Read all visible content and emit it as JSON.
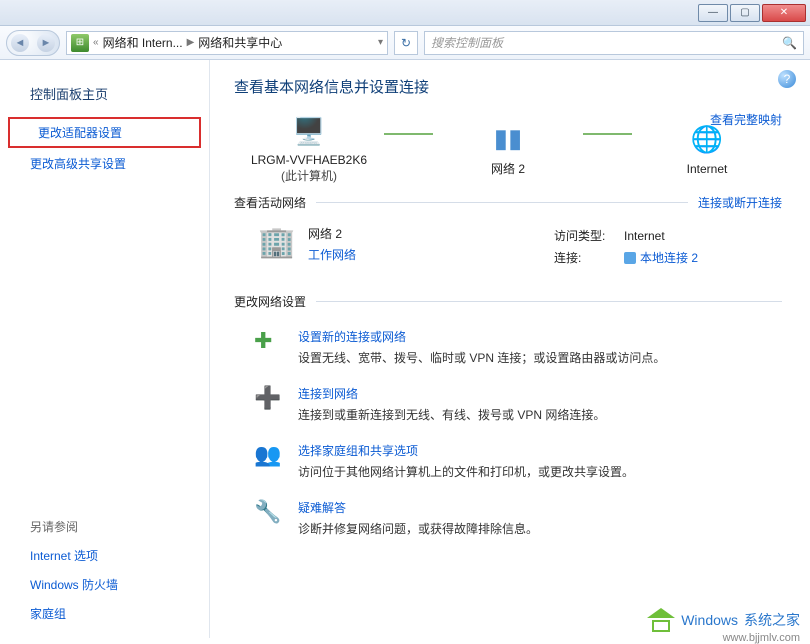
{
  "titlebar": {
    "min": "—",
    "max": "▢",
    "close": "✕"
  },
  "addrbar": {
    "bc1": "网络和 Intern...",
    "bc2": "网络和共享中心",
    "search_placeholder": "搜索控制面板"
  },
  "sidebar": {
    "title": "控制面板主页",
    "links": [
      "更改适配器设置",
      "更改高级共享设置"
    ],
    "see_also": "另请参阅",
    "bottom_links": [
      "Internet 选项",
      "Windows 防火墙",
      "家庭组"
    ]
  },
  "main": {
    "h1": "查看基本网络信息并设置连接",
    "view_map": "查看完整映射",
    "nodes": {
      "pc": "LRGM-VVFHAEB2K6",
      "pc_sub": "(此计算机)",
      "net": "网络  2",
      "internet": "Internet"
    },
    "active_hdr": "查看活动网络",
    "active_right": "连接或断开连接",
    "active": {
      "name": "网络  2",
      "type": "工作网络",
      "access_k": "访问类型:",
      "access_v": "Internet",
      "conn_k": "连接:",
      "conn_v": "本地连接 2"
    },
    "change_hdr": "更改网络设置",
    "settings": [
      {
        "icon": "✚",
        "title": "设置新的连接或网络",
        "desc": "设置无线、宽带、拨号、临时或 VPN 连接；或设置路由器或访问点。"
      },
      {
        "icon": "➕",
        "title": "连接到网络",
        "desc": "连接到或重新连接到无线、有线、拨号或 VPN 网络连接。"
      },
      {
        "icon": "👥",
        "title": "选择家庭组和共享选项",
        "desc": "访问位于其他网络计算机上的文件和打印机，或更改共享设置。"
      },
      {
        "icon": "🔧",
        "title": "疑难解答",
        "desc": "诊断并修复网络问题，或获得故障排除信息。"
      }
    ]
  },
  "watermark": {
    "brand": "Windows",
    "sub": "系统之家",
    "url": "www.bjjmlv.com"
  }
}
